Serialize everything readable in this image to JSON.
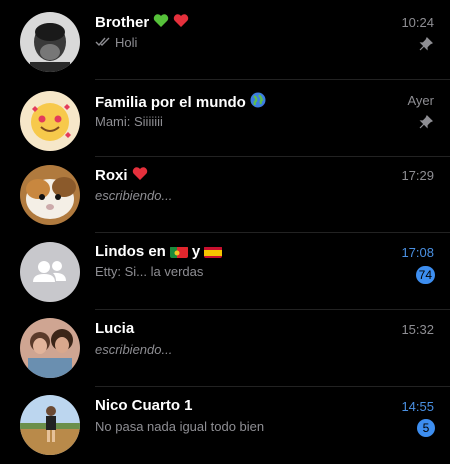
{
  "chats": [
    {
      "name": "Brother",
      "preview": "Holi",
      "time": "10:24",
      "pinned": true,
      "read_receipt": "double-check-icon"
    },
    {
      "name": "Familia por el mundo",
      "preview": "Mami: Siiiiiii",
      "time": "Ayer",
      "pinned": true
    },
    {
      "name": "Roxi",
      "preview": "escribiendo...",
      "time": "17:29"
    },
    {
      "name": "Lindos en",
      "name_mid": "y",
      "preview": "Etty: Si... la verdas",
      "time": "17:08",
      "unread": "74"
    },
    {
      "name": "Lucia",
      "preview": "escribiendo...",
      "time": "15:32"
    },
    {
      "name": "Nico Cuarto 1",
      "preview": "No pasa nada igual todo bien",
      "time": "14:55",
      "unread": "5"
    }
  ],
  "colors": {
    "background": "#000000",
    "muted_text": "#8e8e93",
    "accent_blue": "#4a90e2",
    "badge": "#3d8ef0"
  }
}
